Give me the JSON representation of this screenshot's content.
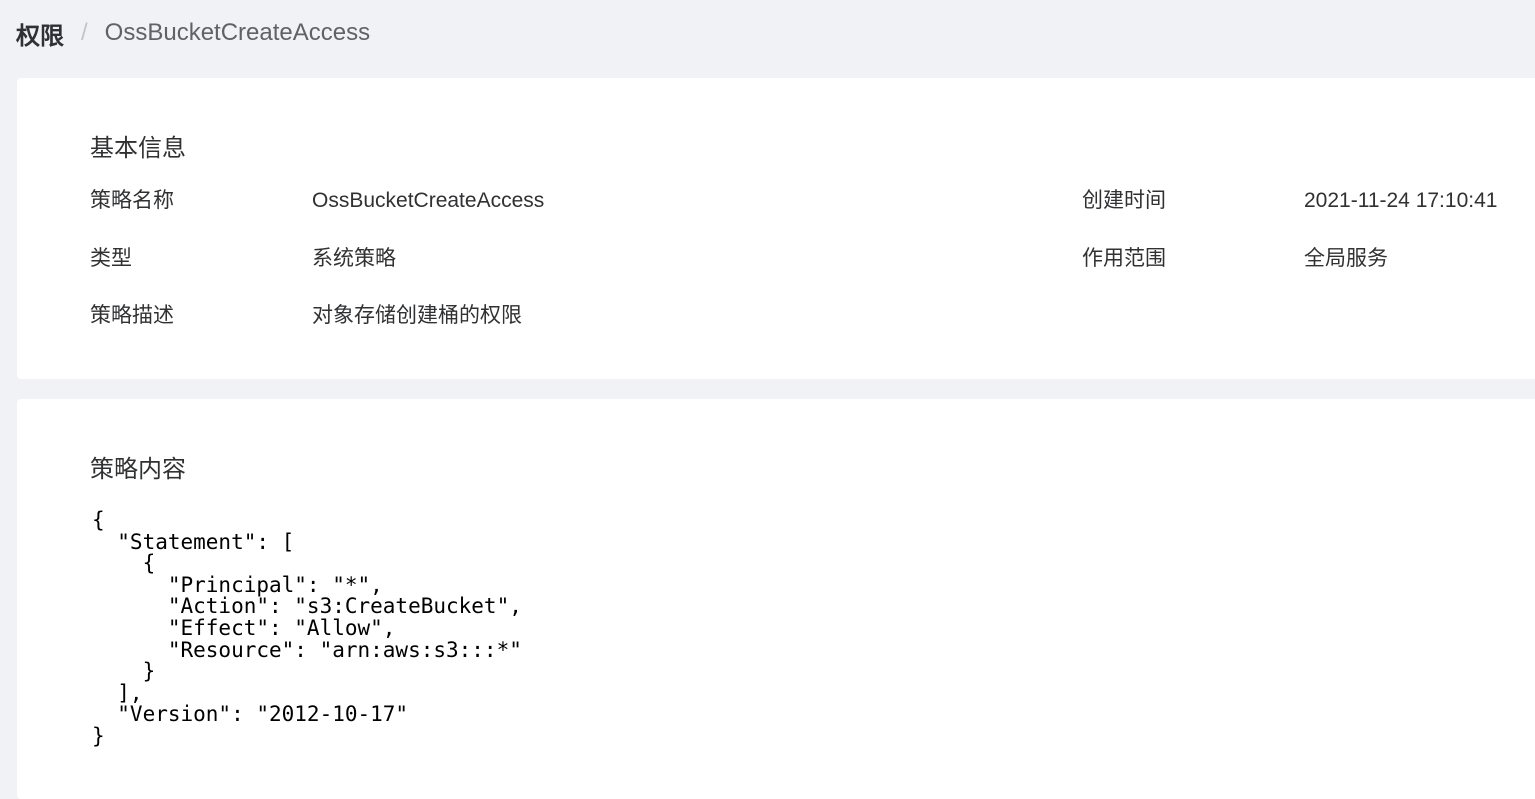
{
  "breadcrumb": {
    "root": "权限",
    "separator": "/",
    "current": "OssBucketCreateAccess"
  },
  "basic_info": {
    "title": "基本信息",
    "fields": {
      "policy_name": {
        "label": "策略名称",
        "value": "OssBucketCreateAccess"
      },
      "created_time": {
        "label": "创建时间",
        "value": "2021-11-24 17:10:41"
      },
      "type": {
        "label": "类型",
        "value": "系统策略"
      },
      "scope": {
        "label": "作用范围",
        "value": "全局服务"
      },
      "description": {
        "label": "策略描述",
        "value": "对象存储创建桶的权限"
      }
    }
  },
  "policy_content": {
    "title": "策略内容",
    "json_text": "{\n  \"Statement\": [\n    {\n      \"Principal\": \"*\",\n      \"Action\": \"s3:CreateBucket\",\n      \"Effect\": \"Allow\",\n      \"Resource\": \"arn:aws:s3:::*\"\n    }\n  ],\n  \"Version\": \"2012-10-17\"\n}"
  },
  "colors": {
    "page_background": "#f0f2f5",
    "card_background": "#ffffff",
    "primary_text": "#303133",
    "secondary_text": "#606266",
    "separator": "#c0c4cc"
  }
}
